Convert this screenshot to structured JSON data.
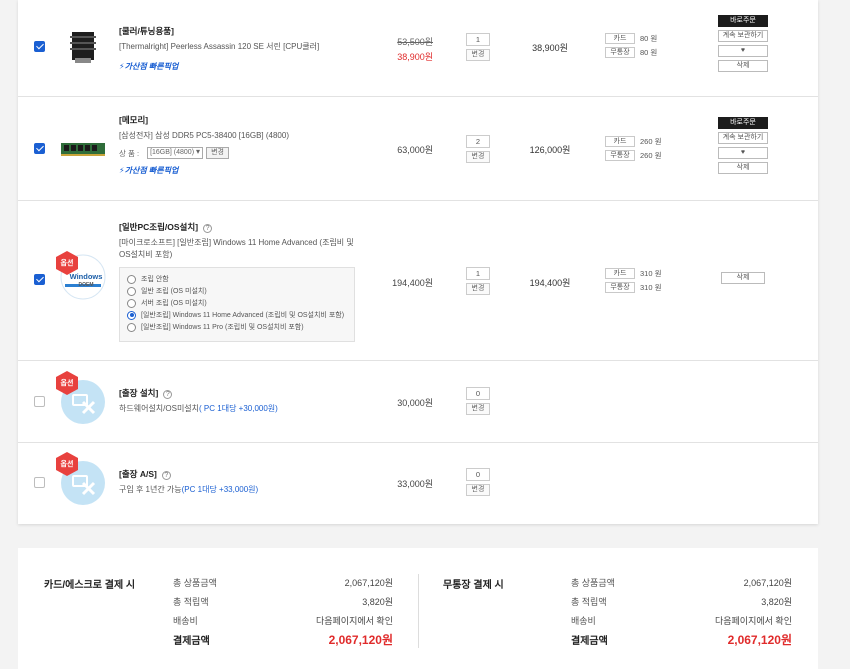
{
  "items": [
    {
      "category": "[쿨러/튜닝용품]",
      "description": "[Thermalright] Peerless Assassin 120 SE 서린 [CPU쿨러]",
      "badge": "가산점 빠른픽업",
      "original_price": "53,500원",
      "price": "38,900원",
      "qty": "1",
      "qty_button": "변경",
      "total": "38,900원",
      "points": [
        {
          "label": "카드",
          "value": "80 원"
        },
        {
          "label": "무통장",
          "value": "80 원"
        }
      ],
      "actions": [
        "바로주문",
        "계속 보관하기",
        "♥",
        "삭제"
      ],
      "checked": true
    },
    {
      "category": "[메모리]",
      "description": "[삼성전자] 삼성 DDR5 PC5-38400 [16GB] (4800)",
      "select_label": "상 품 :",
      "select_value": "[16GB] (4800)",
      "select_button": "변경",
      "badge": "가산점 빠른픽업",
      "price": "63,000원",
      "qty": "2",
      "qty_button": "변경",
      "total": "126,000원",
      "points": [
        {
          "label": "카드",
          "value": "260 원"
        },
        {
          "label": "무통장",
          "value": "260 원"
        }
      ],
      "actions": [
        "바로주문",
        "계속 보관하기",
        "♥",
        "삭제"
      ],
      "checked": true
    },
    {
      "option_badge": "옵션",
      "thumb_text_1": "Windows",
      "thumb_text_2": "DOEM",
      "category": "[일반PC조립/OS설치]",
      "help": "?",
      "description": "[마이크로소프트] [일반조립] Windows 11 Home Advanced (조립비 및 OS설치비 포함)",
      "options": [
        {
          "label": "조립 안함",
          "selected": false
        },
        {
          "label": "일반 조립 (OS 미설치)",
          "selected": false
        },
        {
          "label": "서버 조립 (OS 미설치)",
          "selected": false
        },
        {
          "label": "[일반조립] Windows 11 Home Advanced (조립비 및 OS설치비 포함)",
          "selected": true
        },
        {
          "label": "[일반조립] Windows 11 Pro (조립비 및 OS설치비 포함)",
          "selected": false
        }
      ],
      "price": "194,400원",
      "qty": "1",
      "qty_button": "변경",
      "total": "194,400원",
      "points": [
        {
          "label": "카드",
          "value": "310 원"
        },
        {
          "label": "무통장",
          "value": "310 원"
        }
      ],
      "actions": [
        "삭제"
      ],
      "checked": true
    },
    {
      "option_badge": "옵션",
      "category": "[출장 설치]",
      "help": "?",
      "description": "하드웨어설치/OS미설치",
      "note": "( PC 1대당 +30,000원)",
      "price": "30,000원",
      "qty": "0",
      "qty_button": "변경",
      "checked": false
    },
    {
      "option_badge": "옵션",
      "category": "[출장 A/S]",
      "help": "?",
      "description": "구입 후 1년간 가능",
      "note": "(PC 1대당 +33,000원)",
      "price": "33,000원",
      "qty": "0",
      "qty_button": "변경",
      "checked": false
    }
  ],
  "summary": {
    "card": {
      "title": "카드/에스크로 결제 시",
      "rows": [
        {
          "label": "총 상품금액",
          "value": "2,067,120원"
        },
        {
          "label": "총 적립액",
          "value": "3,820원"
        },
        {
          "label": "배송비",
          "value": "다음페이지에서 확인"
        },
        {
          "label": "결제금액",
          "value": "2,067,120원"
        }
      ]
    },
    "bank": {
      "title": "무통장 결제 시",
      "rows": [
        {
          "label": "총 상품금액",
          "value": "2,067,120원"
        },
        {
          "label": "총 적립액",
          "value": "3,820원"
        },
        {
          "label": "배송비",
          "value": "다음페이지에서 확인"
        },
        {
          "label": "결제금액",
          "value": "2,067,120원"
        }
      ]
    }
  },
  "colors": {
    "accent": "#1a5fd2",
    "price_red": "#e02b2b",
    "option_badge": "#e8413e"
  }
}
